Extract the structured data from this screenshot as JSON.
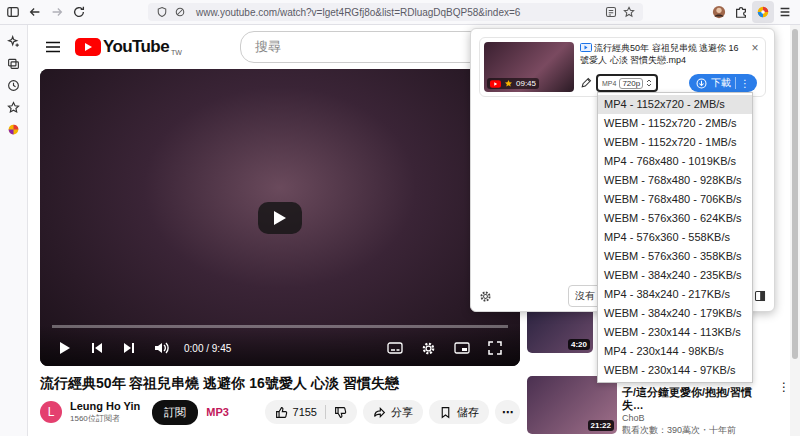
{
  "browser": {
    "url": "www.youtube.com/watch?v=lget4RGfj8o&list=RDluagDqBQP58&index=6",
    "back_enabled": true,
    "forward_enabled": false
  },
  "youtube": {
    "logo": "YouTube",
    "region": "TW",
    "search": {
      "placeholder": "搜尋"
    }
  },
  "player": {
    "time": "0:00 / 9:45",
    "level": 0
  },
  "video": {
    "title": "流行經典50年 容祖兒串燒 逃避你 16號愛人 心淡 習慣失戀",
    "channel": {
      "avatar": "L",
      "name": "Leung Ho Yin",
      "subscribers": "1560位訂閱者"
    },
    "subscribe": "訂閱",
    "mp3": "MP3",
    "likes": "7155",
    "share": "分享",
    "save": "儲存",
    "more": "⋯"
  },
  "recommended": [
    {
      "kind": "covered",
      "duration": "4:20"
    },
    {
      "kind": "card",
      "duration": "21:22",
      "title": "子/這分鐘更愛你/抱抱/習慣失…",
      "channel": "ChoB",
      "views": "觀看次數：390萬次・十年前",
      "more": "⋮"
    }
  ],
  "downloader": {
    "item": {
      "duration": "09:45",
      "filename": "流行經典50年 容祖兒串燒 逃避你 16號愛人 心淡 習慣失戀.mp4",
      "close": "×",
      "format": "MP4",
      "quality": "720p",
      "download": "下載",
      "more": "⋮"
    },
    "footer": {
      "button": "沒有"
    }
  },
  "formats": [
    {
      "label": "MP4 - 1152x720 - 2MB/s",
      "selected": true
    },
    {
      "label": "WEBM - 1152x720 - 2MB/s",
      "selected": false
    },
    {
      "label": "WEBM - 1152x720 - 1MB/s",
      "selected": false
    },
    {
      "label": "MP4 - 768x480 - 1019KB/s",
      "selected": false
    },
    {
      "label": "WEBM - 768x480 - 928KB/s",
      "selected": false
    },
    {
      "label": "WEBM - 768x480 - 706KB/s",
      "selected": false
    },
    {
      "label": "WEBM - 576x360 - 624KB/s",
      "selected": false
    },
    {
      "label": "MP4 - 576x360 - 558KB/s",
      "selected": false
    },
    {
      "label": "WEBM - 576x360 - 358KB/s",
      "selected": false
    },
    {
      "label": "WEBM - 384x240 - 235KB/s",
      "selected": false
    },
    {
      "label": "MP4 - 384x240 - 217KB/s",
      "selected": false
    },
    {
      "label": "WEBM - 384x240 - 179KB/s",
      "selected": false
    },
    {
      "label": "WEBM - 230x144 - 113KB/s",
      "selected": false
    },
    {
      "label": "MP4 - 230x144 - 98KB/s",
      "selected": false
    },
    {
      "label": "WEBM - 230x144 - 97KB/s",
      "selected": false
    }
  ]
}
